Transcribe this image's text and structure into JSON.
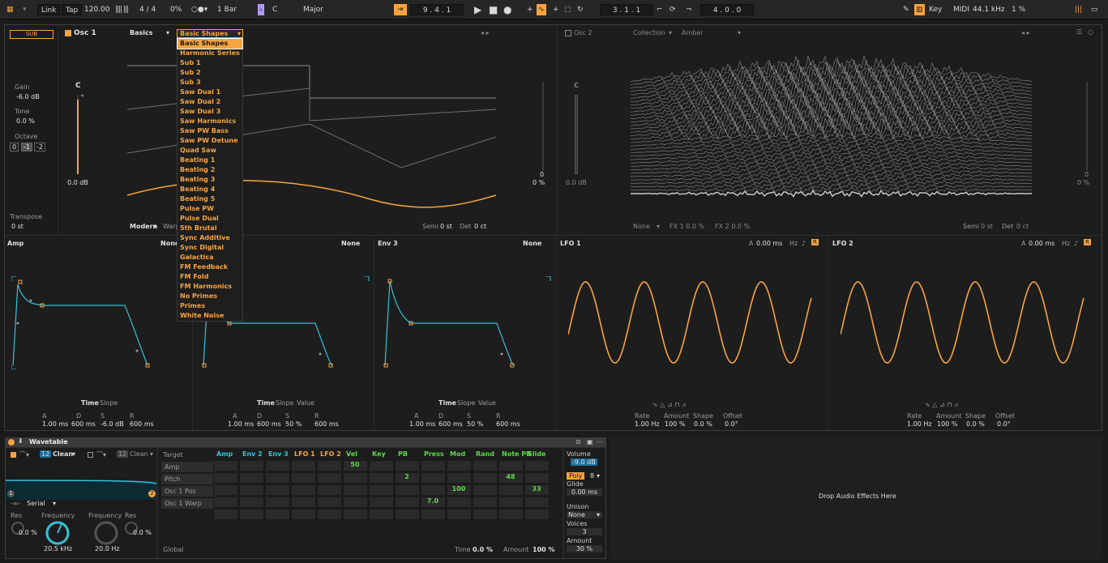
{
  "transport": {
    "link": "Link",
    "tap": "Tap",
    "tempo": "120.00",
    "meter": "4 / 4",
    "swing": "0%",
    "quantize": "1 Bar",
    "key": "C",
    "scale": "Major",
    "position": "9 . 4 . 1",
    "loop_start": "3 . 1 . 1",
    "loop_length": "4 . 0 . 0",
    "key_label": "Key",
    "midi_label": "MIDI",
    "sample_rate": "44.1 kHz",
    "cpu": "1 %"
  },
  "sub": {
    "label": "SUB",
    "gain_label": "Gain",
    "gain": "-6.0 dB",
    "tone_label": "Tone",
    "tone": "0.0 %",
    "octave_label": "Octave",
    "octaves": [
      "0",
      "-1",
      "-2"
    ],
    "transpose_label": "Transpose",
    "transpose": "0 st"
  },
  "osc1": {
    "title": "Osc 1",
    "category": "Basics",
    "wavetable": "Basic Shapes",
    "pitch_note": "C",
    "level": "0.0 dB",
    "mode": "Modern",
    "warp_label": "Warp",
    "semi_label": "Semi",
    "semi": "0 st",
    "det_label": "Det",
    "det": "0 ct",
    "right_level": "0 %",
    "right_level_top": "0"
  },
  "osc2": {
    "title": "Osc 2",
    "category": "Collection",
    "wavetable": "Amber",
    "pitch_note": "C",
    "level": "0.0 dB",
    "fx_mode": "None",
    "fx1": "FX 1 0.0 %",
    "fx2": "FX 2 0.0 %",
    "semi_label": "Semi",
    "semi": "0 st",
    "det_label": "Det",
    "det": "0 ct",
    "right_level": "0 %",
    "right_level_top": "0"
  },
  "menu": {
    "items": [
      "Basic Shapes",
      "Harmonic Series",
      "Sub 1",
      "Sub 2",
      "Sub 3",
      "Saw Dual 1",
      "Saw Dual 2",
      "Saw Dual 3",
      "Saw Harmonics",
      "Saw PW Bass",
      "Saw PW Detune",
      "Quad Saw",
      "Beating 1",
      "Beating 2",
      "Beating 3",
      "Beating 4",
      "Beating 5",
      "Pulse PW",
      "Pulse Dual",
      "5th Brutal",
      "Sync Additive",
      "Sync Digital",
      "Galactica",
      "FM Feedback",
      "FM Fold",
      "FM Harmonics",
      "No Primes",
      "Primes",
      "White Noise"
    ]
  },
  "env": [
    {
      "title": "Amp",
      "mode": "None",
      "time": "Time",
      "slope": "Slope",
      "value": "",
      "a": "1.00 ms",
      "d": "600 ms",
      "s": "-6.0 dB",
      "r": "600 ms"
    },
    {
      "title": "",
      "mode": "None",
      "time": "Time",
      "slope": "Slope",
      "value": "Value",
      "a": "1.00 ms",
      "d": "600 ms",
      "s": "50 %",
      "r": "600 ms"
    },
    {
      "title": "Env 3",
      "mode": "None",
      "time": "Time",
      "slope": "Slope",
      "value": "Value",
      "a": "1.00 ms",
      "d": "600 ms",
      "s": "50 %",
      "r": "600 ms"
    }
  ],
  "env_labels": {
    "a": "A",
    "d": "D",
    "s": "S",
    "r": "R"
  },
  "lfo": [
    {
      "title": "LFO 1",
      "attack_label": "A",
      "attack": "0.00 ms",
      "hz": "Hz",
      "rate": "1.00 Hz",
      "amount": "100 %",
      "shape": "0.0 %",
      "offset": "0.0°",
      "r": "R"
    },
    {
      "title": "LFO 2",
      "attack_label": "A",
      "attack": "0.00 ms",
      "hz": "Hz",
      "rate": "1.00 Hz",
      "amount": "100 %",
      "shape": "0.0 %",
      "offset": "0.0°",
      "r": "R"
    }
  ],
  "lfo_labels": {
    "rate": "Rate",
    "amount": "Amount",
    "shape": "Shape",
    "offset": "Offset"
  },
  "device": {
    "title": "Wavetable",
    "filter1_type": "Clean",
    "filter1_num": "12",
    "filter2_type": "Clean",
    "filter2_num": "12",
    "routing": "Serial",
    "res_label": "Res",
    "res": "0.0 %",
    "freq_label": "Frequency",
    "freq1": "20.5 kHz",
    "freq2": "20.0 Hz",
    "res2": "0.0 %",
    "node1": "2",
    "node2": "1"
  },
  "matrix": {
    "target_label": "Target",
    "cols": [
      "Amp",
      "Env 2",
      "Env 3",
      "LFO 1",
      "LFO 2",
      "Vel",
      "Key",
      "PB",
      "Press",
      "Mod",
      "Rand",
      "Note PB",
      "Slide"
    ],
    "rows": [
      "Amp",
      "Pitch",
      "Osc 1 Pos",
      "Osc 1 Warp"
    ],
    "values": [
      {
        "text": "50"
      },
      {
        "text": "2"
      },
      {
        "text": "48"
      },
      {
        "text": "100"
      },
      {
        "text": "33"
      },
      {
        "text": "7.0"
      }
    ],
    "global": "Global",
    "time_label": "Time",
    "time": "0.0 %",
    "amount_label": "Amount",
    "amount": "100 %"
  },
  "voice": {
    "volume_label": "Volume",
    "volume": "-9.0 dB",
    "poly": "Poly",
    "voices_count": "8",
    "glide_label": "Glide",
    "glide": "0.00 ms",
    "unison_label": "Unison",
    "unison": "None",
    "voices_label": "Voices",
    "voices": "3",
    "amount_label": "Amount",
    "amount": "30 %"
  },
  "drop": "Drop Audio Effects Here"
}
